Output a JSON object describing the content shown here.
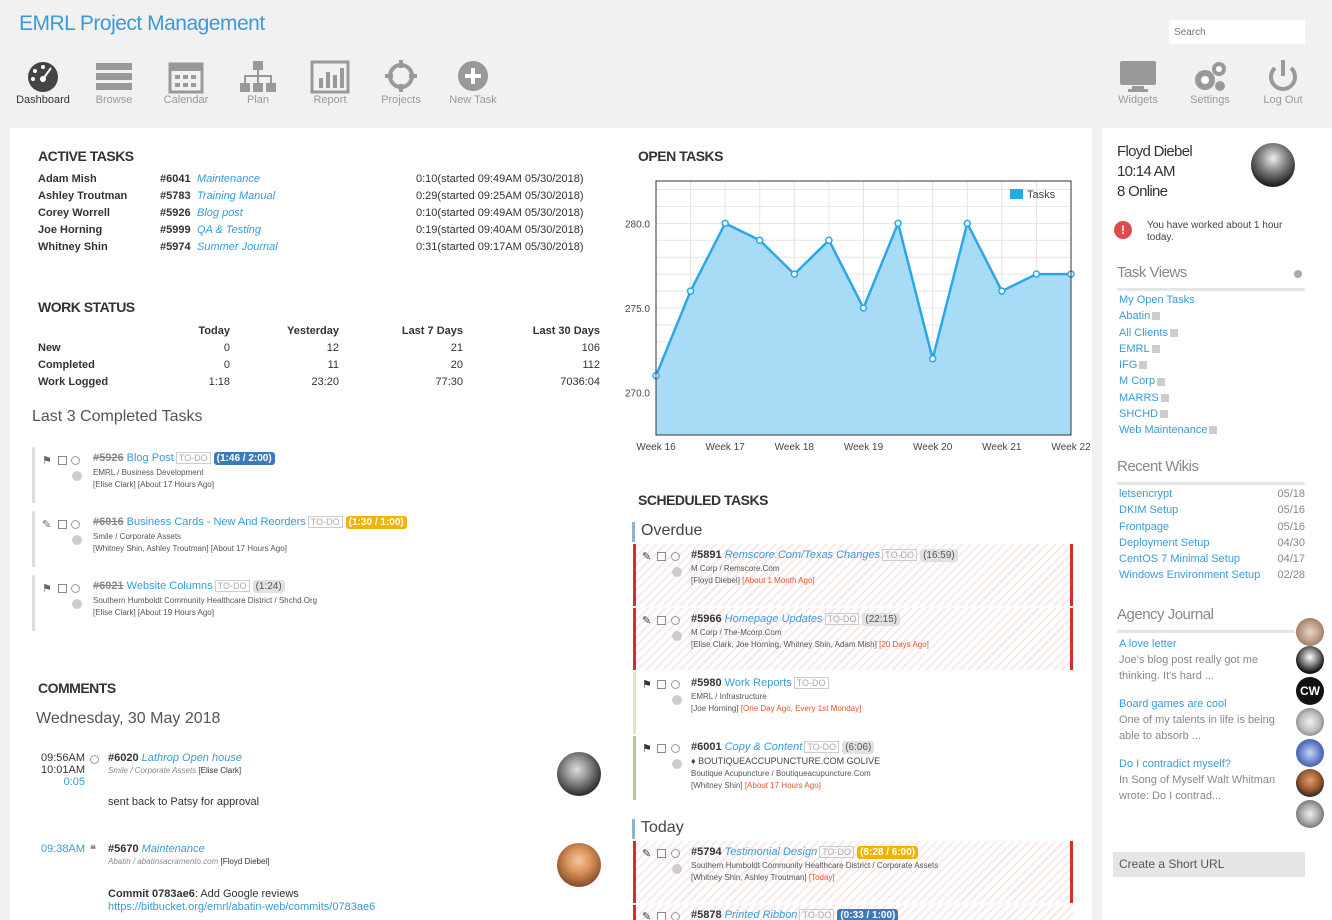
{
  "app_title": "EMRL Project Management",
  "search_placeholder": "Search",
  "nav": [
    {
      "label": "Dashboard",
      "icon": "dashboard-icon"
    },
    {
      "label": "Browse",
      "icon": "list-icon"
    },
    {
      "label": "Calendar",
      "icon": "calendar-icon"
    },
    {
      "label": "Plan",
      "icon": "sitemap-icon"
    },
    {
      "label": "Report",
      "icon": "bar-chart-icon"
    },
    {
      "label": "Projects",
      "icon": "crosshair-icon"
    },
    {
      "label": "New Task",
      "icon": "plus-circle-icon"
    }
  ],
  "nav_right": [
    {
      "label": "Widgets",
      "icon": "monitor-icon"
    },
    {
      "label": "Settings",
      "icon": "gears-icon"
    },
    {
      "label": "Log Out",
      "icon": "power-icon"
    }
  ],
  "active_tasks": {
    "title": "ACTIVE TASKS",
    "rows": [
      {
        "user": "Adam Mish",
        "num": "#6041",
        "name": "Maintenance",
        "time": "0:10(started 09:49AM 05/30/2018)"
      },
      {
        "user": "Ashley Troutman",
        "num": "#5783",
        "name": "Training Manual",
        "time": "0:29(started 09:25AM 05/30/2018)"
      },
      {
        "user": "Corey Worrell",
        "num": "#5926",
        "name": "Blog post",
        "time": "0:10(started 09:49AM 05/30/2018)"
      },
      {
        "user": "Joe Horning",
        "num": "#5999",
        "name": "QA & Testing",
        "time": "0:19(started 09:40AM 05/30/2018)"
      },
      {
        "user": "Whitney Shin",
        "num": "#5974",
        "name": "Summer Journal",
        "time": "0:31(started 09:17AM 05/30/2018)"
      }
    ]
  },
  "work_status": {
    "title": "WORK STATUS",
    "headers": [
      "Today",
      "Yesterday",
      "Last 7 Days",
      "Last 30 Days"
    ],
    "rows": [
      {
        "label": "New",
        "vals": [
          "0",
          "12",
          "21",
          "106"
        ]
      },
      {
        "label": "Completed",
        "vals": [
          "0",
          "11",
          "20",
          "112"
        ]
      },
      {
        "label": "Work Logged",
        "vals": [
          "1:18",
          "23:20",
          "77:30",
          "7036:04"
        ]
      }
    ]
  },
  "completed": {
    "title": "Last 3 Completed Tasks",
    "items": [
      {
        "num": "#5926",
        "name": "Blog Post",
        "tag": "TO-DO",
        "time": "(1:46 / 2:00)",
        "client": "EMRL / Business Development",
        "people": "[Elise Clark] [About 17 Hours Ago]"
      },
      {
        "num": "#6016",
        "name": "Business Cards - New And Reorders",
        "tag": "TO-DO",
        "time": "(1:30 / 1:00)",
        "client": "Smile / Corporate Assets",
        "people": "[Whitney Shin, Ashley Troutman] [About 17 Hours Ago]"
      },
      {
        "num": "#6021",
        "name": "Website Columns",
        "tag": "TO-DO",
        "time": "(1:24)",
        "client": "Southern Humboldt Community Healthcare District / Shchd.Org",
        "people": "[Elise Clark] [About 19 Hours Ago]"
      }
    ]
  },
  "comments": {
    "title": "COMMENTS",
    "date": "Wednesday, 30 May 2018",
    "items": [
      {
        "time1": "09:56AM",
        "time2": "10:01AM",
        "dur": "0:05",
        "num": "#6020",
        "name": "Lathrop Open house",
        "client": "Smile / Corporate Assets",
        "person": "[Elise Clark]",
        "body": "sent back to Patsy for approval"
      },
      {
        "time1": "09:38AM",
        "num": "#5670",
        "name": "Maintenance",
        "client": "Abatin / abatinsacramento.com",
        "person": "[Floyd Diebel]",
        "commit_label": "Commit 0783ae6",
        "commit_text": ": Add Google reviews",
        "url": "https://bitbucket.org/emrl/abatin-web/commits/0783ae6"
      }
    ]
  },
  "open_tasks": {
    "title": "OPEN TASKS"
  },
  "chart_data": {
    "type": "area",
    "x": [
      "Week 16",
      "Week 17",
      "Week 18",
      "Week 19",
      "Week 20",
      "Week 21",
      "Week 22"
    ],
    "points_x": [
      0,
      0.5,
      1,
      1.5,
      2,
      2.5,
      3,
      3.5,
      4,
      4.5,
      5,
      5.5,
      6
    ],
    "values": [
      271,
      276,
      280,
      279,
      277,
      279,
      275,
      280,
      272,
      280,
      276,
      277,
      277
    ],
    "ylim": [
      267.5,
      282.5
    ],
    "yticks": [
      "270.0",
      "275.0",
      "280.0"
    ],
    "ytick_vals": [
      270,
      275,
      280
    ],
    "series": [
      {
        "name": "Tasks",
        "color": "#29a8e8",
        "fill": "#a8dcf6"
      }
    ],
    "legend": "top-right",
    "grid": true
  },
  "scheduled": {
    "title": "SCHEDULED TASKS",
    "overdue_label": "Overdue",
    "today_label": "Today",
    "overdue": [
      {
        "num": "#5891",
        "name": "Remscore.Com/Texas Changes",
        "tag": "TO-DO",
        "time": "(16:59)",
        "client": "M Corp / Remscore.Com",
        "people": "[Floyd Diebel]",
        "when": "[About 1 Month Ago]",
        "bar": "#d32f2f"
      },
      {
        "num": "#5966",
        "name": "Homepage Updates",
        "tag": "TO-DO",
        "time": "(22:15)",
        "client": "M Corp / The-Mcorp.Com",
        "people": "[Elise Clark, Joe Horning, Whitney Shin, Adam Mish]",
        "when": "[20 Days Ago]",
        "bar": "#d32f2f"
      },
      {
        "num": "#5980",
        "name": "Work Reports",
        "tag": "TO-DO",
        "time": "",
        "client": "EMRL / Infrastructure",
        "people": "[Joe Horning]",
        "when": "[One Day Ago, Every 1st Monday]",
        "bar": "#e8e0bc"
      },
      {
        "num": "#6001",
        "name": "Copy & Content",
        "tag": "TO-DO",
        "time": "(6:06)",
        "extra": "♦ BOUTIQUEACCUPUNCTURE.COM GOLIVE",
        "client": "Boutique Acupuncture / Boutiqueacupuncture.Com",
        "people": "[Whitney Shin]",
        "when": "[About 17 Hours Ago]",
        "bar": "#a5d28a"
      }
    ],
    "today": [
      {
        "num": "#5794",
        "name": "Testimonial Design",
        "tag": "TO-DO",
        "time": "(8:28 / 6:00)",
        "client": "Southern Humboldt Community Healthcare District / Corporate Assets",
        "people": "[Whitney Shin, Ashley Troutman]",
        "when": "[Today]"
      },
      {
        "num": "#5878",
        "name": "Printed Ribbon",
        "tag": "TO-DO",
        "time": "(0:33 / 1:00)"
      }
    ]
  },
  "user": {
    "name": "Floyd Diebel",
    "time": "10:14 AM",
    "online": "8 Online",
    "notice": "You have worked about 1 hour today."
  },
  "task_views": {
    "title": "Task Views",
    "items": [
      "My Open Tasks",
      "Abatin",
      "All Clients",
      "EMRL",
      "IFG",
      "M Corp",
      "MARRS",
      "SHCHD",
      "Web Maintenance"
    ]
  },
  "wikis": {
    "title": "Recent Wikis",
    "items": [
      {
        "name": "letsencrypt",
        "date": "05/18"
      },
      {
        "name": "DKIM Setup",
        "date": "05/16"
      },
      {
        "name": "Frontpage",
        "date": "05/16"
      },
      {
        "name": "Deployment Setup",
        "date": "04/30"
      },
      {
        "name": "CentOS 7 Minimal Setup",
        "date": "04/17"
      },
      {
        "name": "Windows Environment Setup",
        "date": "02/28"
      }
    ]
  },
  "journal": {
    "title": "Agency Journal",
    "items": [
      {
        "title": "A love letter",
        "text": "Joe's blog post really got me thinking. It's hard ..."
      },
      {
        "title": "Board games are cool",
        "text": "One of my talents in life is being able to absorb ..."
      },
      {
        "title": "Do I contradict myself?",
        "text": "In Song of Myself Walt Whitman wrote: Do I contrad..."
      }
    ]
  },
  "short_url": "Create a Short URL",
  "avatar_initials": "CW"
}
